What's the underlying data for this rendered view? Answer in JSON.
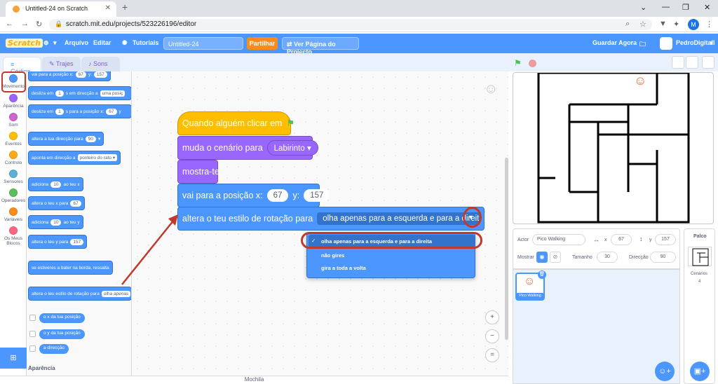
{
  "browser": {
    "tab_title": "Untitled-24 on Scratch",
    "tab_close": "✕",
    "new_tab": "+",
    "url": "scratch.mit.edu/projects/523226196/editor",
    "profile_initial": "M"
  },
  "menubar": {
    "logo": "Scratch",
    "language_caret": "▾",
    "file": "Arquivo",
    "edit": "Editar",
    "tutorials": "Tutoriais",
    "project_title": "Untitled-24",
    "share": "Partilhar",
    "see_project_page": "Ver Página do Projecto",
    "save_now": "Guardar Agora",
    "username": "PedroDigitall"
  },
  "editor_tabs": {
    "code": "Código",
    "costumes": "Trajes",
    "sounds": "Sons"
  },
  "categories": [
    {
      "label": "Movimento",
      "color": "#4c97ff"
    },
    {
      "label": "Aparência",
      "color": "#9966ff"
    },
    {
      "label": "Som",
      "color": "#cf63cf"
    },
    {
      "label": "Eventos",
      "color": "#ffbf00"
    },
    {
      "label": "Controlo",
      "color": "#ffab19"
    },
    {
      "label": "Sensores",
      "color": "#5cb1d6"
    },
    {
      "label": "Operadores",
      "color": "#59c059"
    },
    {
      "label": "Variáveis",
      "color": "#ff8c1a"
    },
    {
      "label": "Os Meus Blocos",
      "color": "#ff6680"
    }
  ],
  "palette": {
    "goto_xy": {
      "text": "vai para a posição x:",
      "x": "67",
      "y_label": "y:",
      "y": "157"
    },
    "glide_to": {
      "text": "desliza em",
      "secs": "1",
      "mid": "s em direcção a",
      "target": "uma posiç"
    },
    "glide_xy": {
      "text": "desliza em",
      "secs": "1",
      "mid": "s para a posição x:",
      "x": "67",
      "y_label": "y"
    },
    "turn_direction": {
      "text": "altera a tua direcção para",
      "value": "90"
    },
    "point_towards": {
      "text": "aponta em direcção a",
      "target": "ponteiro do rato ▾"
    },
    "change_x": {
      "text": "adiciona",
      "value": "10",
      "suffix": "ao teu x"
    },
    "set_x": {
      "text": "altera o teu x para",
      "value": "67"
    },
    "change_y": {
      "text": "adiciona",
      "value": "10",
      "suffix": "ao teu y"
    },
    "set_y": {
      "text": "altera o teu y para",
      "value": "157"
    },
    "bounce": "se estiveres a bater na borda, ressalta",
    "rotation_style": {
      "text": "altera o teu estilo de rotação para",
      "value": "olha apenas"
    },
    "x_position": "o x da tua posição",
    "y_position": "o y da tua posição",
    "direction": "a direcção",
    "next_section": "Aparência"
  },
  "script": {
    "hat": "Quando alguém clicar em",
    "switch_backdrop": {
      "text": "muda o cenário para",
      "value": "Labirinto ▾"
    },
    "show": "mostra-te",
    "goto": {
      "text": "vai para a posição x:",
      "x": "67",
      "y_label": "y:",
      "y": "157"
    },
    "rotation": {
      "text": "altera o teu estilo de rotação para",
      "value": "olha apenas para a esquerda e para a direita"
    }
  },
  "dropdown": {
    "check": "✓",
    "options": [
      "olha apenas para a esquerda e para a direita",
      "não gires",
      "gira a toda a volta"
    ],
    "selected_index": 0
  },
  "zoom": {
    "in": "+",
    "out": "−",
    "reset": "="
  },
  "backpack": "Mochila",
  "sprite_info": {
    "sprite_label": "Actor",
    "sprite_name": "Pico Walking",
    "x_label": "x",
    "x": "67",
    "y_label": "y",
    "y": "157",
    "show_label": "Mostrar",
    "size_label": "Tamanho",
    "size": "30",
    "direction_label": "Direcção",
    "direction": "90"
  },
  "sprite_list": {
    "sprite_name": "Pico Walking",
    "delete": "🗑"
  },
  "stage_panel": {
    "title": "Palco",
    "backdrops_label": "Cenários",
    "backdrops_count": "4"
  },
  "colors": {
    "accent": "#4c97ff",
    "highlight_red": "#c0392b",
    "looks": "#9966ff",
    "events": "#ffbf00"
  }
}
